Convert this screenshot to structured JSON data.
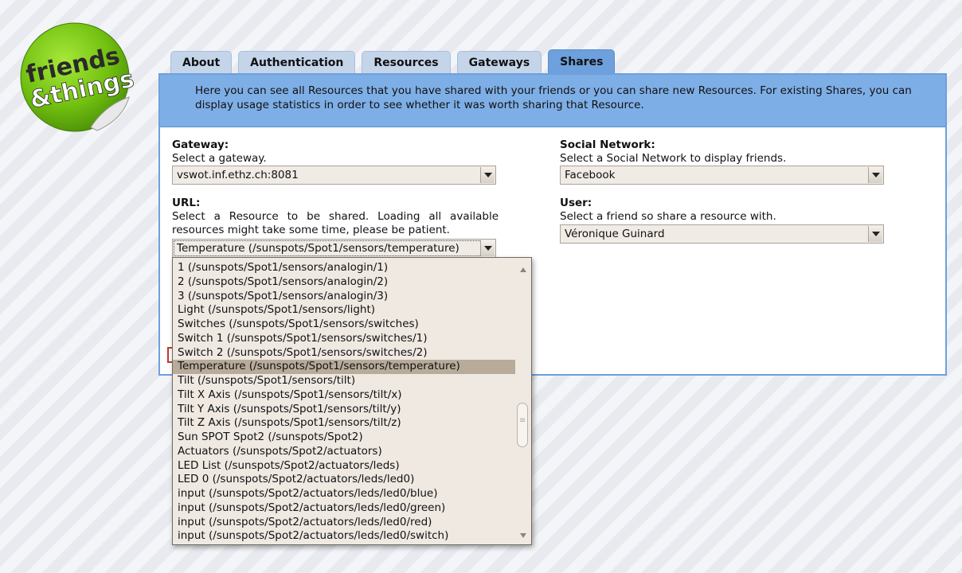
{
  "logo": {
    "line1": "friends",
    "line2": "&things"
  },
  "tabs": [
    {
      "label": "About"
    },
    {
      "label": "Authentication"
    },
    {
      "label": "Resources"
    },
    {
      "label": "Gateways"
    },
    {
      "label": "Shares",
      "active": true
    }
  ],
  "intro": "Here you can see all Resources that you have shared with your friends or you can share new Resources. For existing Shares, you can display usage statistics in order to see whether it was worth sharing that Resource.",
  "gateway": {
    "label": "Gateway:",
    "help": "Select a gateway.",
    "value": "vswot.inf.ethz.ch:8081"
  },
  "url": {
    "label": "URL:",
    "help": "Select a Resource to be shared. Loading all available resources might take some time, please be patient.",
    "value": "Temperature (/sunspots/Spot1/sensors/temperature)"
  },
  "social": {
    "label": "Social Network:",
    "help": "Select a Social Network to display friends.",
    "value": "Facebook"
  },
  "user": {
    "label": "User:",
    "help": "Select a friend so share a resource with.",
    "value": "Véronique Guinard"
  },
  "dropdown_options": [
    "1 (/sunspots/Spot1/sensors/analogin/1)",
    "2 (/sunspots/Spot1/sensors/analogin/2)",
    "3 (/sunspots/Spot1/sensors/analogin/3)",
    "Light (/sunspots/Spot1/sensors/light)",
    "Switches (/sunspots/Spot1/sensors/switches)",
    "Switch 1 (/sunspots/Spot1/sensors/switches/1)",
    "Switch 2 (/sunspots/Spot1/sensors/switches/2)",
    "Temperature (/sunspots/Spot1/sensors/temperature)",
    "Tilt (/sunspots/Spot1/sensors/tilt)",
    "Tilt X Axis (/sunspots/Spot1/sensors/tilt/x)",
    "Tilt Y Axis (/sunspots/Spot1/sensors/tilt/y)",
    "Tilt Z Axis (/sunspots/Spot1/sensors/tilt/z)",
    "Sun SPOT Spot2 (/sunspots/Spot2)",
    "Actuators (/sunspots/Spot2/actuators)",
    "LED List (/sunspots/Spot2/actuators/leds)",
    "LED 0 (/sunspots/Spot2/actuators/leds/led0)",
    "input (/sunspots/Spot2/actuators/leds/led0/blue)",
    "input (/sunspots/Spot2/actuators/leds/led0/green)",
    "input (/sunspots/Spot2/actuators/leds/led0/red)",
    "input (/sunspots/Spot2/actuators/leds/led0/switch)"
  ],
  "selected_index": 7,
  "colors": {
    "tab_active": "#6da0dc",
    "intro_bg": "#7eaee6",
    "logo_green": "#7cc814"
  }
}
